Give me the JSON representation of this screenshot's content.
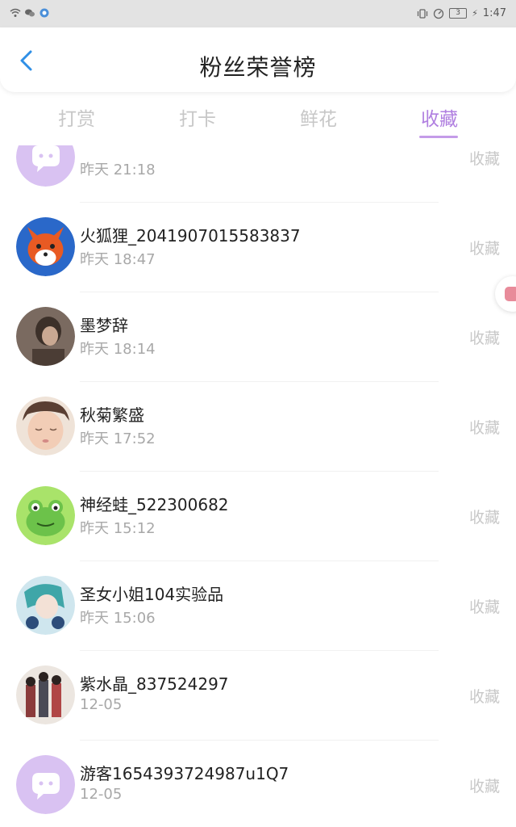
{
  "status_bar": {
    "time": "1:47",
    "battery": "3"
  },
  "header": {
    "title": "粉丝荣誉榜"
  },
  "tabs": [
    {
      "label": "打赏"
    },
    {
      "label": "打卡"
    },
    {
      "label": "鲜花"
    },
    {
      "label": "收藏"
    }
  ],
  "active_tab": "收藏",
  "rows": [
    {
      "name": "",
      "time": "昨天 21:18",
      "action": "收藏"
    },
    {
      "name": "火狐狸_2041907015583837",
      "time": "昨天 18:47",
      "action": "收藏"
    },
    {
      "name": "墨梦辞",
      "time": "昨天 18:14",
      "action": "收藏"
    },
    {
      "name": "秋菊繁盛",
      "time": "昨天 17:52",
      "action": "收藏"
    },
    {
      "name": "神经蛙_522300682",
      "time": "昨天 15:12",
      "action": "收藏"
    },
    {
      "name": "圣女小姐104实验品",
      "time": "昨天 15:06",
      "action": "收藏"
    },
    {
      "name": "紫水晶_837524297",
      "time": "12-05",
      "action": "收藏"
    },
    {
      "name": "游客1654393724987u1Q7",
      "time": "12-05",
      "action": "收藏"
    }
  ],
  "colors": {
    "accent": "#b07fe0",
    "avatar_default": "#d9c2f2"
  }
}
